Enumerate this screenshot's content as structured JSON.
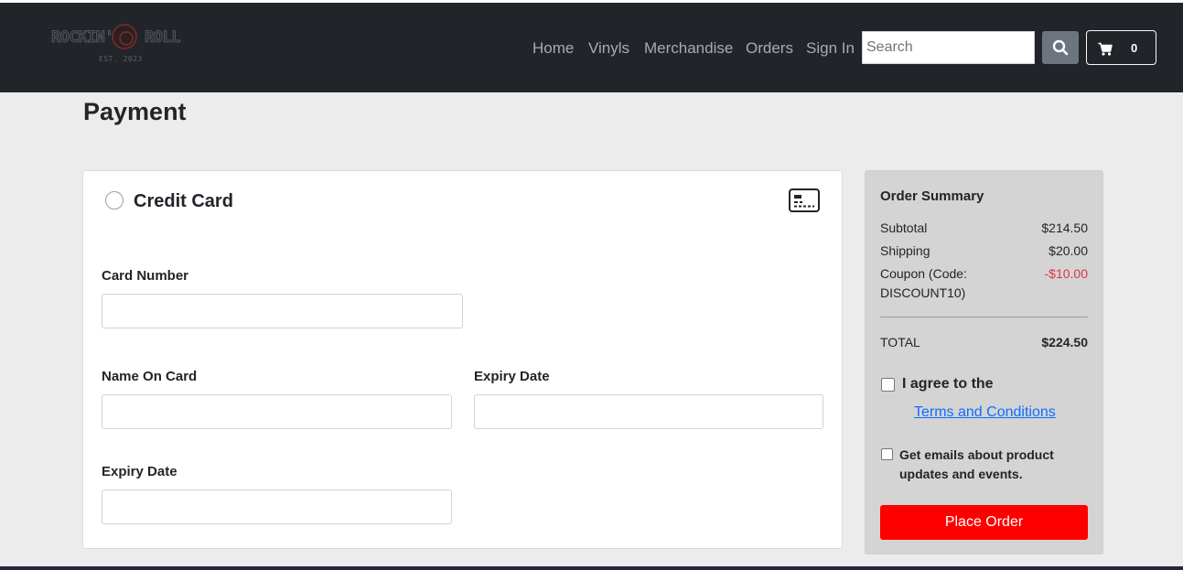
{
  "brand": {
    "logo_left": "ROCKIN'",
    "logo_right": "ROLL",
    "logo_est": "EST. 2023"
  },
  "nav": {
    "links": [
      "Home",
      "Vinyls",
      "Merchandise",
      "Orders",
      "Sign In"
    ],
    "search_placeholder": "Search",
    "cart_count": "0"
  },
  "page": {
    "title": "Payment"
  },
  "payment": {
    "method_label": "Credit Card",
    "method_icon": "credit-card-icon",
    "fields": {
      "card_number": "Card Number",
      "name_on_card": "Name On Card",
      "expiry_date_1": "Expiry Date",
      "expiry_date_2": "Expiry Date"
    }
  },
  "summary": {
    "title": "Order Summary",
    "subtotal_label": "Subtotal",
    "subtotal_value": "$214.50",
    "shipping_label": "Shipping",
    "shipping_value": "$20.00",
    "coupon_label": "Coupon (Code: DISCOUNT10)",
    "coupon_value": "-$10.00",
    "total_label": "TOTAL",
    "total_value": "$224.50",
    "agree_label": "I agree to the",
    "terms_link": "Terms and Conditions",
    "emails_label": "Get emails about product updates and events.",
    "place_order": "Place Order"
  },
  "colors": {
    "navbar": "#212529",
    "background": "#ececec",
    "accent_button": "#ff0000",
    "discount": "#dc3545",
    "link": "#0d6efd"
  }
}
